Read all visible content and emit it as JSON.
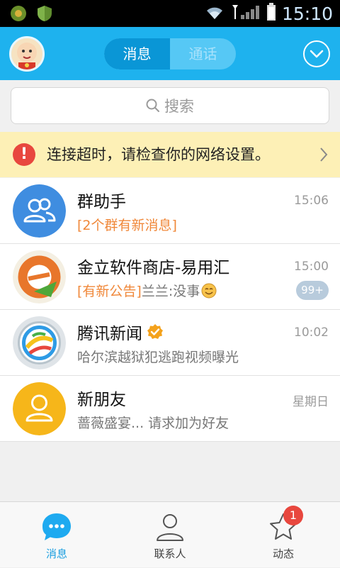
{
  "status": {
    "time": "15:10"
  },
  "header": {
    "tab_messages": "消息",
    "tab_calls": "通话"
  },
  "search": {
    "placeholder": "搜索"
  },
  "banner": {
    "text": "连接超时，请检查你的网络设置。"
  },
  "conversations": [
    {
      "title": "群助手",
      "time": "15:06",
      "tag": "[2个群有新消息]",
      "text": "",
      "badge": ""
    },
    {
      "title": "金立软件商店-易用汇",
      "time": "15:00",
      "tag": "[有新公告]",
      "text": "兰兰:没事",
      "badge": "99+"
    },
    {
      "title": "腾讯新闻",
      "time": "10:02",
      "tag": "",
      "text": "哈尔滨越狱犯逃跑视频曝光",
      "badge": ""
    },
    {
      "title": "新朋友",
      "time": "星期日",
      "tag": "",
      "text": "蔷薇盛宴... 请求加为好友",
      "badge": ""
    }
  ],
  "tabs": [
    {
      "label": "消息"
    },
    {
      "label": "联系人"
    },
    {
      "label": "动态",
      "badge": "1"
    }
  ],
  "colors": {
    "accent": "#1eb2ee",
    "warning_bg": "#fdf0b6",
    "tag": "#f0883a"
  }
}
